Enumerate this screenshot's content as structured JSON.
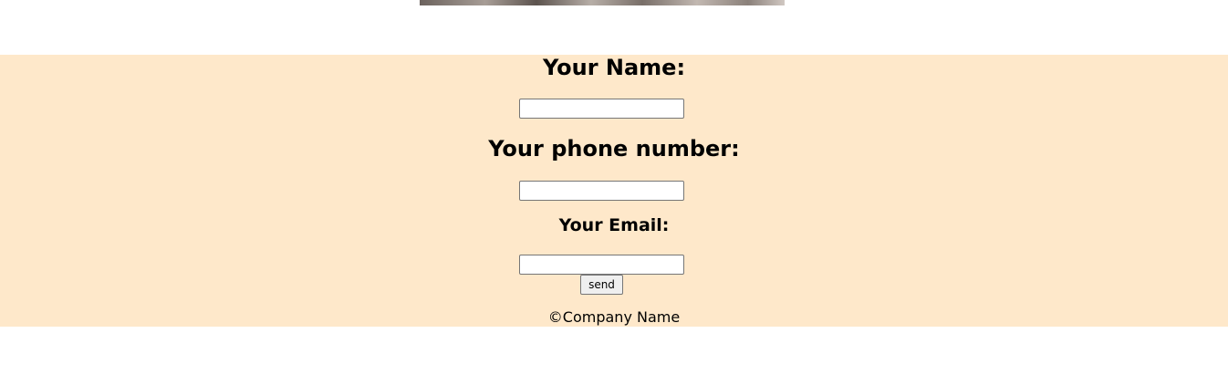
{
  "form": {
    "name_label": "Your Name:",
    "name_value": "",
    "phone_label": "Your phone number:",
    "phone_value": "",
    "email_label": "Your Email:",
    "email_value": "",
    "send_label": "send"
  },
  "footer": {
    "copyright": "©Company Name"
  },
  "colors": {
    "panel_background": "#fee8ca",
    "page_background": "#ffffff"
  }
}
